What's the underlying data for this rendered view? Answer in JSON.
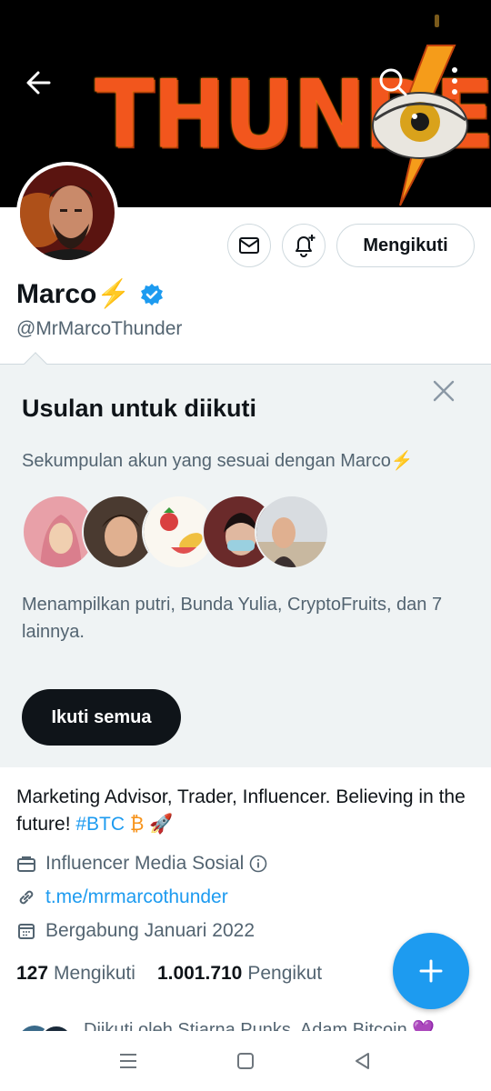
{
  "banner": {
    "text": "THUNDER"
  },
  "header": {
    "back_icon": "arrow-left-icon",
    "search_icon": "search-icon",
    "more_icon": "more-vertical-icon"
  },
  "profile": {
    "display_name": "Marco⚡",
    "handle": "@MrMarcoThunder",
    "follow_button_label": "Mengikuti",
    "verified": true
  },
  "suggestions": {
    "title": "Usulan untuk diikuti",
    "subtitle": "Sekumpulan akun yang sesuai dengan Marco⚡",
    "description": "Menampilkan putri, Bunda Yulia, CryptoFruits, dan 7 lainnya.",
    "follow_all_label": "Ikuti semua"
  },
  "bio": {
    "text_start": "Marketing Advisor, Trader, Influencer. Believing in the future! ",
    "hashtag": "#BTC",
    "text_end": " ₿  🚀",
    "category": "Influencer Media Sosial",
    "website": "t.me/mrmarcothunder",
    "joined": "Bergabung Januari 2022"
  },
  "stats": {
    "following_count": "127",
    "following_label": "Mengikuti",
    "followers_count": "1.001.710",
    "followers_label": "Pengikut"
  },
  "followed_by": {
    "text": "Diikuti oleh Stiarna Punks, Adam Bitcoin 💜"
  },
  "colors": {
    "accent": "#1d9bf0",
    "suggestion_bg": "#eff3f4",
    "banner_text": "#f2561d",
    "secondary_text": "#536471"
  }
}
